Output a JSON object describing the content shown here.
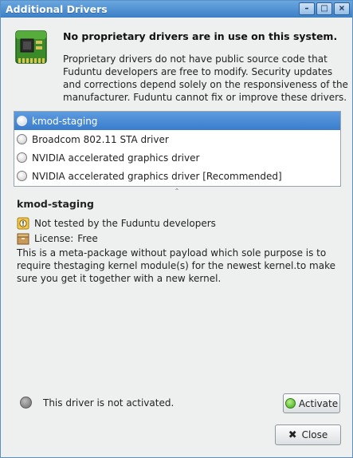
{
  "window": {
    "title": "Additional Drivers",
    "controls": {
      "minimize": "–",
      "maximize": "□",
      "close": "×"
    }
  },
  "header": {
    "icon": "driver-chip-icon",
    "title": "No proprietary drivers are in use on this system.",
    "description": "Proprietary drivers do not have public source code that Fuduntu developers are free to modify. Security updates and corrections depend solely on the responsiveness of the manufacturer. Fuduntu cannot fix or improve these drivers."
  },
  "drivers": [
    {
      "label": "kmod-staging",
      "selected": true
    },
    {
      "label": "Broadcom 802.11 STA driver",
      "selected": false
    },
    {
      "label": "NVIDIA accelerated graphics driver",
      "selected": false
    },
    {
      "label": "NVIDIA accelerated graphics driver [Recommended]",
      "selected": false
    }
  ],
  "details": {
    "title": "kmod-staging",
    "support_note": "Not tested by the Fuduntu developers",
    "license_label": "License:",
    "license_value": "Free",
    "description": "This is a meta-package without payload which sole purpose is to require thestaging kernel module(s) for the newest kernel.to make sure you get it together with a new kernel."
  },
  "status": {
    "text": "This driver is not activated."
  },
  "buttons": {
    "activate": "Activate",
    "close": "Close"
  },
  "colors": {
    "selection": "#3a7dcb",
    "titlebar": "#3c7fc6",
    "activate_indicator": "#3fa716"
  }
}
